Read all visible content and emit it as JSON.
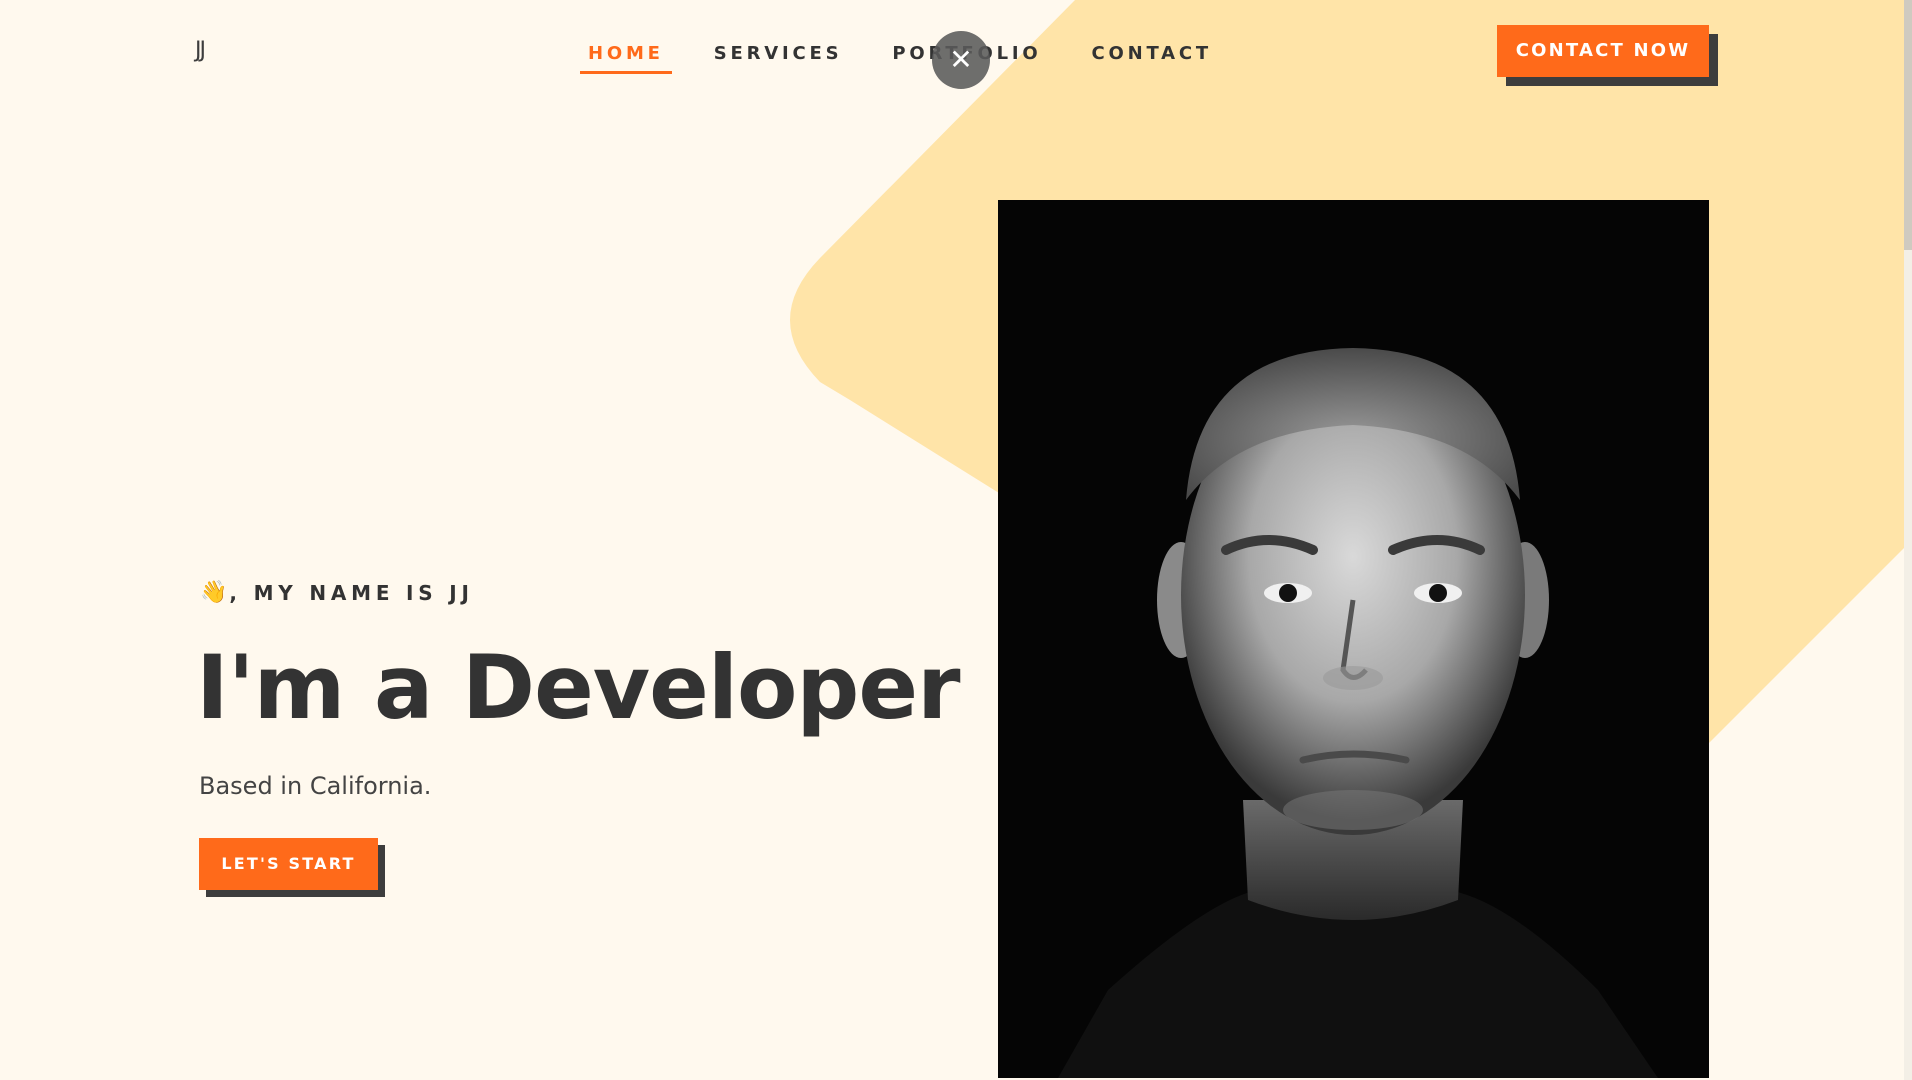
{
  "header": {
    "logo": "JJ",
    "nav": [
      {
        "label": "HOME",
        "active": true
      },
      {
        "label": "SERVICES",
        "active": false
      },
      {
        "label": "PORTFOLIO",
        "active": false
      },
      {
        "label": "CONTACT",
        "active": false
      }
    ],
    "cta_label": "CONTACT NOW",
    "close_icon": "close-icon"
  },
  "hero": {
    "greeting_icon": "waving-hand-icon",
    "greeting_emoji": "👋",
    "greeting": ", MY NAME IS JJ",
    "headline": "I'm a Developer",
    "subline": "Based in California.",
    "start_label": "LET'S START",
    "portrait_icon": "person-portrait-icon"
  },
  "colors": {
    "background": "#fff9ee",
    "accent": "#ff6a1a",
    "shape": "#ffe4a8",
    "text": "#333333",
    "shadow": "#3d3d3d"
  }
}
